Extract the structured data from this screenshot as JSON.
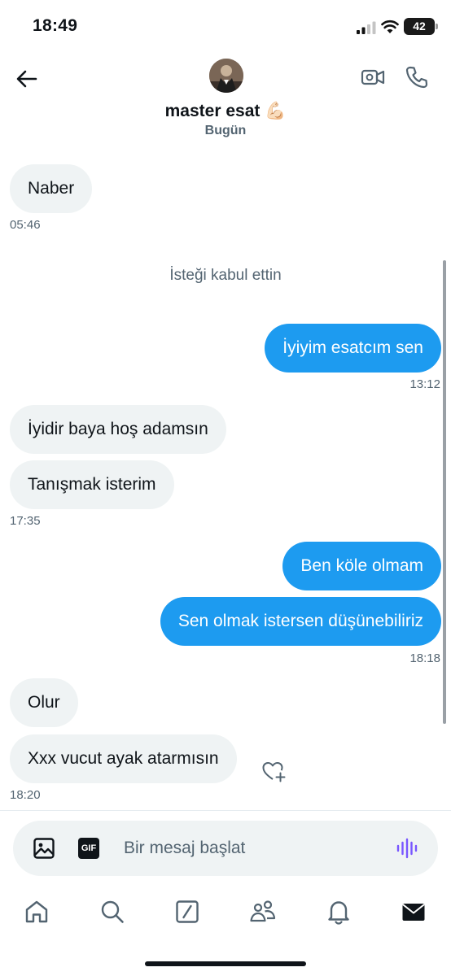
{
  "status_bar": {
    "time": "18:49",
    "battery": "42"
  },
  "header": {
    "contact_name": "master esat 💪🏻",
    "date_peek": "Bugün"
  },
  "messages": {
    "m1": {
      "text": "Naber",
      "time": "05:46"
    },
    "system": "İsteği kabul ettin",
    "m2": {
      "text": "İyiyim esatcım sen",
      "time": "13:12"
    },
    "m3": {
      "text": "İyidir baya hoş adamsın"
    },
    "m4": {
      "text": "Tanışmak isterim",
      "time": "17:35"
    },
    "m5": {
      "text": "Ben köle olmam"
    },
    "m6": {
      "text": "Sen olmak istersen düşünebiliriz",
      "time": "18:18"
    },
    "m7": {
      "text": "Olur"
    },
    "m8": {
      "text": "Xxx vucut ayak atarmısın",
      "time": "18:20"
    }
  },
  "composer": {
    "placeholder": "Bir mesaj başlat",
    "gif_label": "GIF"
  },
  "icons": {
    "back": "arrow-left-icon",
    "video": "video-camera-icon",
    "phone": "phone-icon",
    "react": "heart-plus-icon",
    "image": "image-icon",
    "voice": "voice-wave-icon",
    "tabs": [
      "home-icon",
      "search-icon",
      "grok-icon",
      "communities-icon",
      "notifications-icon",
      "messages-icon"
    ]
  },
  "colors": {
    "accent": "#1d9bf0",
    "incoming_bubble": "#eff3f4",
    "voice": "#7856ff"
  }
}
